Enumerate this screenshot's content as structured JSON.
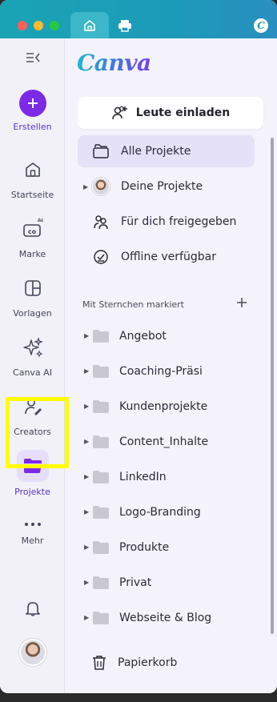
{
  "titlebar": {
    "tabs": [
      {
        "name": "home-tab",
        "icon": "home-icon"
      },
      {
        "name": "print-tab",
        "icon": "printer-icon"
      }
    ],
    "profile_badge": "C"
  },
  "rail": {
    "collapse_icon": "sidebar-collapse-icon",
    "items": [
      {
        "label": "Erstellen",
        "icon": "plus-icon"
      },
      {
        "label": "Startseite",
        "icon": "home-icon"
      },
      {
        "label": "Marke",
        "icon": "brand-icon"
      },
      {
        "label": "Vorlagen",
        "icon": "templates-icon"
      },
      {
        "label": "Canva AI",
        "icon": "sparkle-icon"
      },
      {
        "label": "Creators",
        "icon": "creators-icon"
      },
      {
        "label": "Projekte",
        "icon": "folder-icon"
      },
      {
        "label": "Mehr",
        "icon": "more-icon"
      }
    ],
    "notification_icon": "bell-icon"
  },
  "panel": {
    "logo": "Canva",
    "invite_label": "Leute einladen",
    "nav": [
      {
        "label": "Alle Projekte",
        "active": true
      },
      {
        "label": "Deine Projekte"
      },
      {
        "label": "Für dich freigegeben"
      },
      {
        "label": "Offline verfügbar"
      }
    ],
    "section_title": "Mit Sternchen markiert",
    "folders": [
      "Angebot",
      "Coaching-Präsi",
      "Kundenprojekte",
      "Content_Inhalte",
      "LinkedIn",
      "Logo-Branding",
      "Produkte",
      "Privat",
      "Webseite & Blog"
    ],
    "trash_label": "Papierkorb"
  },
  "colors": {
    "accent": "#7d2ae8",
    "titlebar": "#1c9bb8",
    "highlight": "#ffff00"
  }
}
